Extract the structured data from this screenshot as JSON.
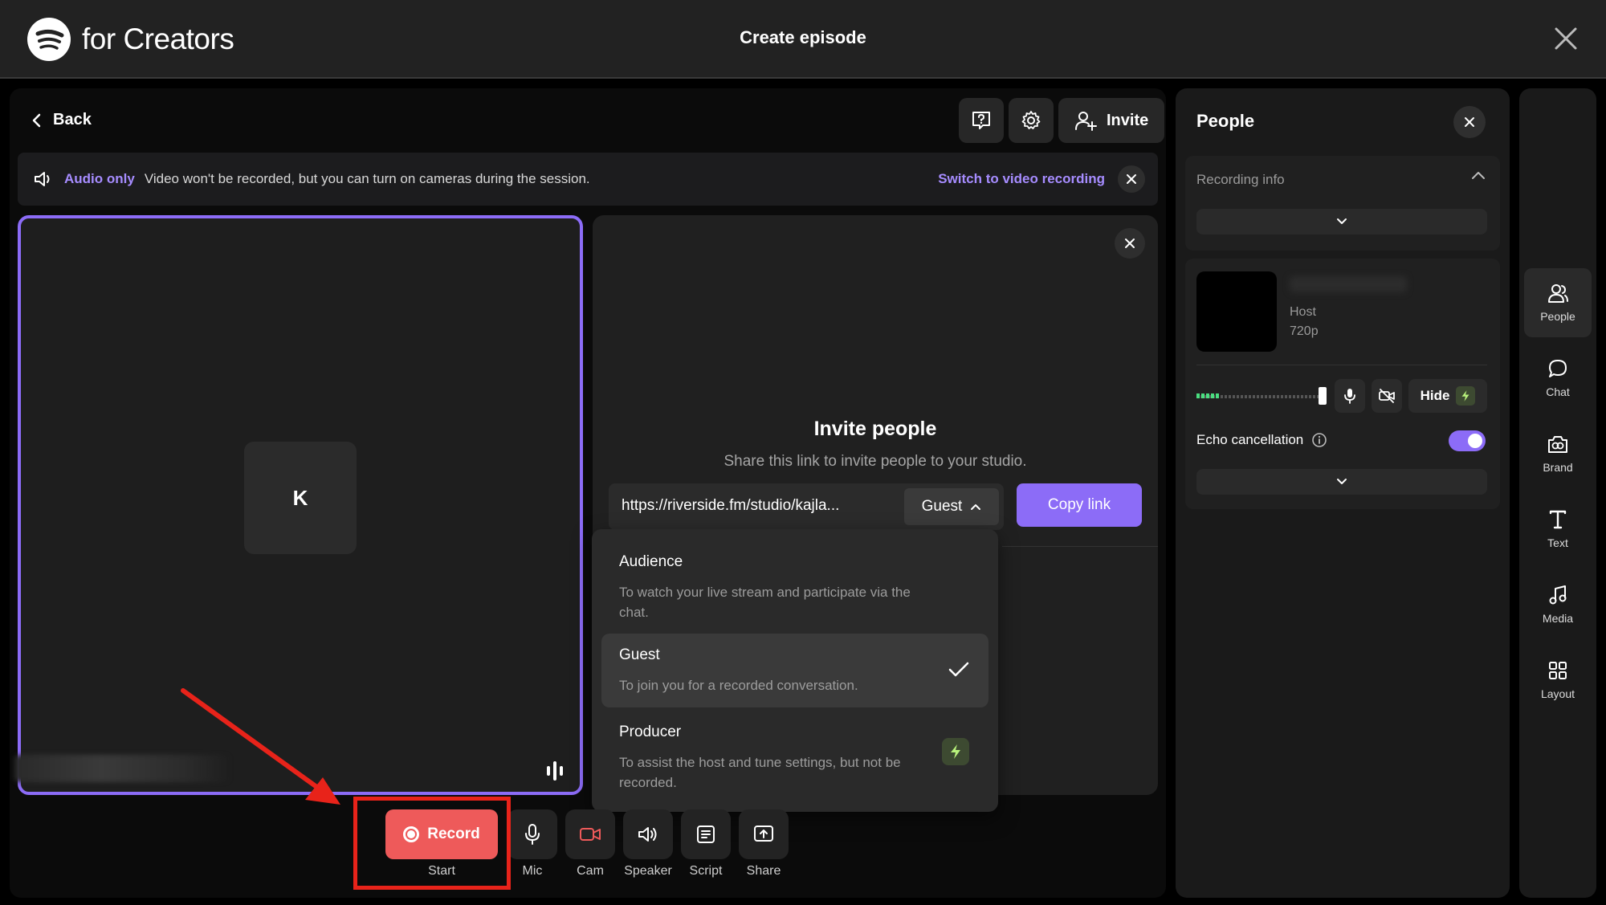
{
  "header": {
    "logo_text": "for Creators",
    "title": "Create episode"
  },
  "studio": {
    "back_label": "Back",
    "invite_label": "Invite",
    "banner": {
      "tag": "Audio only",
      "message": "Video won't be recorded, but you can turn on cameras during the session.",
      "switch_label": "Switch to video recording"
    },
    "tile": {
      "avatar_initial": "K"
    },
    "invite_panel": {
      "title": "Invite people",
      "subtitle": "Share this link to invite people to your studio.",
      "link": "https://riverside.fm/studio/kajla...",
      "role": "Guest",
      "copy_label": "Copy link"
    },
    "role_menu": {
      "items": [
        {
          "title": "Audience",
          "desc": "To watch your live stream and participate via the chat."
        },
        {
          "title": "Guest",
          "desc": "To join you for a recorded conversation."
        },
        {
          "title": "Producer",
          "desc": "To assist the host and tune settings, but not be recorded."
        }
      ],
      "selected": "Guest"
    }
  },
  "controls": {
    "record_label": "Record",
    "record_sub": "Start",
    "mic": "Mic",
    "cam": "Cam",
    "speaker": "Speaker",
    "script": "Script",
    "share": "Share"
  },
  "people_panel": {
    "title": "People",
    "recording_info": "Recording info",
    "host_role": "Host",
    "host_resolution": "720p",
    "hide_label": "Hide",
    "echo_label": "Echo cancellation",
    "echo_enabled": true
  },
  "rail": {
    "items": [
      "People",
      "Chat",
      "Brand",
      "Text",
      "Media",
      "Layout"
    ],
    "active": "People"
  },
  "colors": {
    "accent": "#8c6cf7",
    "record": "#ee5a5a",
    "highlight": "#e8231a"
  }
}
